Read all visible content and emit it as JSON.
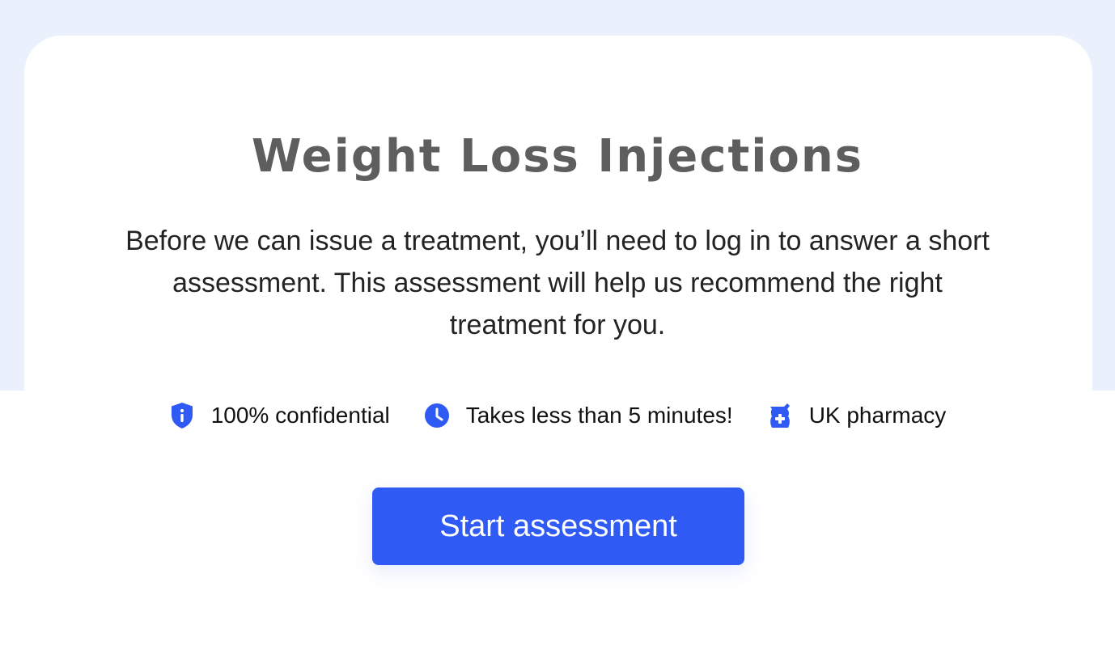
{
  "page": {
    "title": "Weight Loss Injections",
    "description": "Before we can issue a treatment, you’ll need to log in to answer a short assessment. This assessment will help us recommend the right treatment for you."
  },
  "features": [
    {
      "icon": "shield-info-icon",
      "label": "100% confidential"
    },
    {
      "icon": "clock-icon",
      "label": "Takes less than 5 minutes!"
    },
    {
      "icon": "pharmacy-icon",
      "label": "UK pharmacy"
    }
  ],
  "cta": {
    "label": "Start assessment"
  },
  "colors": {
    "accent": "#2f5bf4",
    "background": "#eaf0fc",
    "title": "#5e5e5e",
    "text": "#232323"
  }
}
